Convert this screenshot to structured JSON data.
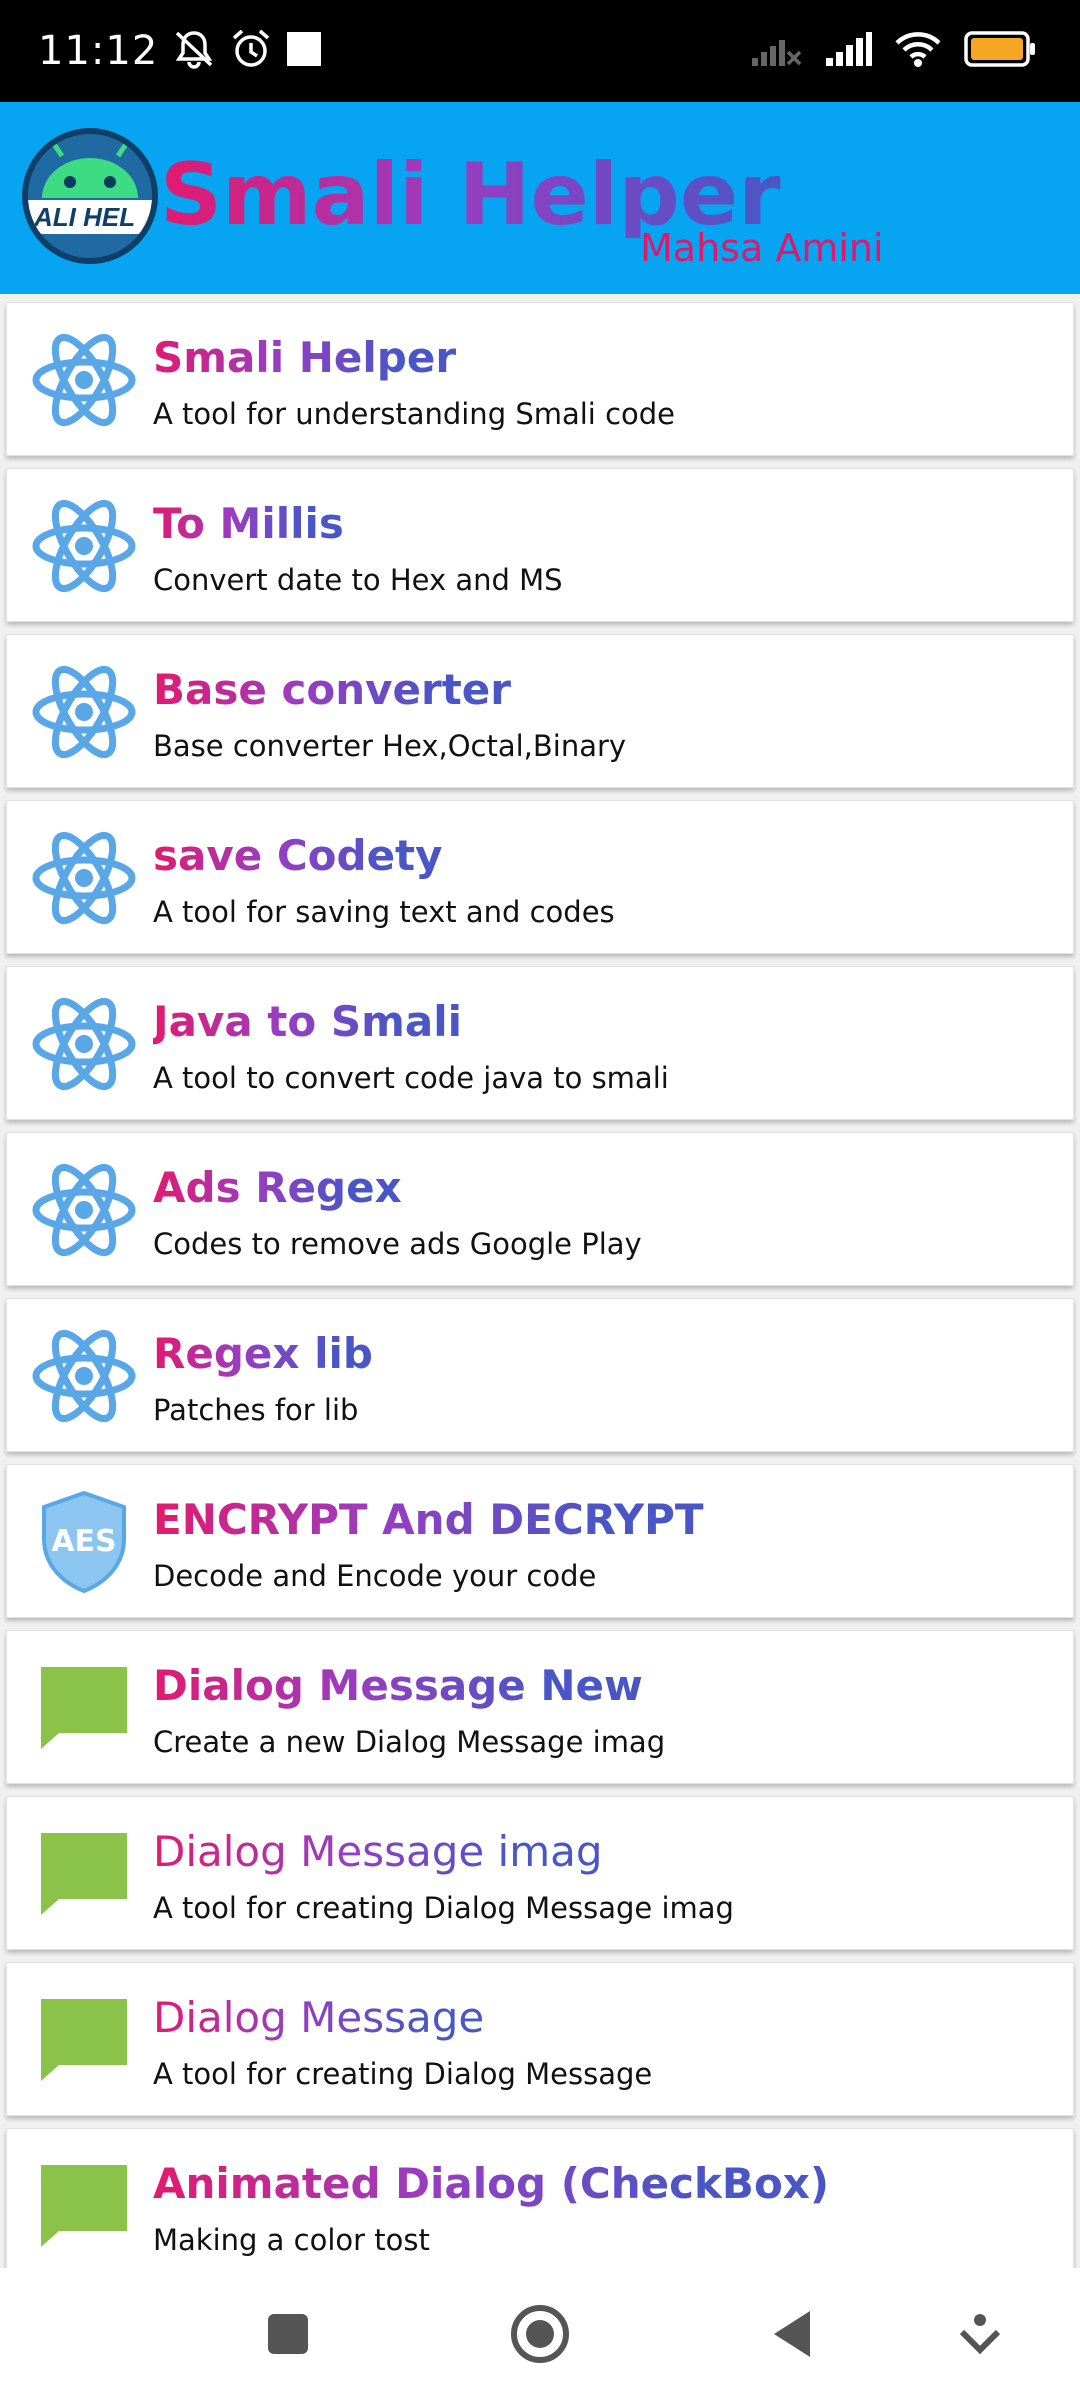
{
  "status_bar": {
    "time": "11:12"
  },
  "header": {
    "title": "Smali Helper",
    "subtitle": "Mahsa Amini",
    "logo_text": "ALI HEL"
  },
  "colors": {
    "header_bg": "#06a4f1",
    "gradient_start": "#e21a6f",
    "gradient_mid": "#9b3cc0",
    "gradient_end": "#4a56c6",
    "message_icon": "#8bc34a",
    "atom_icon": "#5aa7e8"
  },
  "tools": [
    {
      "title": "Smali Helper",
      "description": "A tool for understanding Smali code",
      "icon": "atom-icon",
      "bold": true
    },
    {
      "title": "To Millis",
      "description": "Convert date to Hex and MS",
      "icon": "atom-icon",
      "bold": true
    },
    {
      "title": "Base converter",
      "description": "Base converter Hex,Octal,Binary",
      "icon": "atom-icon",
      "bold": true
    },
    {
      "title": "save Codety",
      "description": "A tool for saving text and codes",
      "icon": "atom-icon",
      "bold": true
    },
    {
      "title": "Java to Smali",
      "description": "A tool to convert code java to smali",
      "icon": "atom-icon",
      "bold": true
    },
    {
      "title": "Ads Regex",
      "description": "Codes to remove ads Google Play",
      "icon": "atom-icon",
      "bold": true
    },
    {
      "title": "Regex lib",
      "description": "Patches for lib",
      "icon": "atom-icon",
      "bold": true
    },
    {
      "title": "ENCRYPT And DECRYPT",
      "description": "Decode and Encode your code",
      "icon": "aes-shield-icon",
      "icon_text": "AES",
      "bold": true
    },
    {
      "title": "Dialog Message New",
      "description": "Create a new Dialog Message imag",
      "icon": "message-bubble-icon",
      "bold": true
    },
    {
      "title": "Dialog Message imag",
      "description": "A tool for creating Dialog Message imag",
      "icon": "message-bubble-icon",
      "bold": false
    },
    {
      "title": "Dialog Message",
      "description": "A tool for creating Dialog Message",
      "icon": "message-bubble-icon",
      "bold": false
    },
    {
      "title": "Animated Dialog (CheckBox)",
      "description": "Making a color tost",
      "icon": "message-bubble-icon",
      "bold": true
    }
  ]
}
